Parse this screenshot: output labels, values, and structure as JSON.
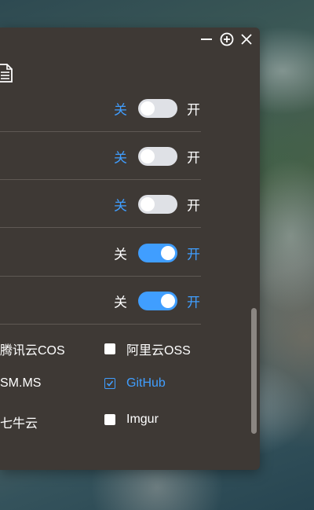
{
  "window": {
    "minimize_icon": "minus-icon",
    "maximize_icon": "plus-circle-icon",
    "close_icon": "close-icon"
  },
  "toggles": [
    {
      "off_label": "关",
      "on_label": "开",
      "state": "off"
    },
    {
      "off_label": "关",
      "on_label": "开",
      "state": "off"
    },
    {
      "off_label": "关",
      "on_label": "开",
      "state": "off"
    },
    {
      "off_label": "关",
      "on_label": "开",
      "state": "on"
    },
    {
      "off_label": "关",
      "on_label": "开",
      "state": "on"
    }
  ],
  "uploaders": [
    {
      "label": "腾讯云COS",
      "checked": false
    },
    {
      "label": "阿里云OSS",
      "checked": false
    },
    {
      "label": "SM.MS",
      "checked": false
    },
    {
      "label": "GitHub",
      "checked": true
    },
    {
      "label": "七牛云",
      "checked": false
    },
    {
      "label": "Imgur",
      "checked": false
    }
  ],
  "colors": {
    "accent": "#409eff",
    "panel": "#3e3935",
    "switch_off": "#dfe1e6"
  }
}
